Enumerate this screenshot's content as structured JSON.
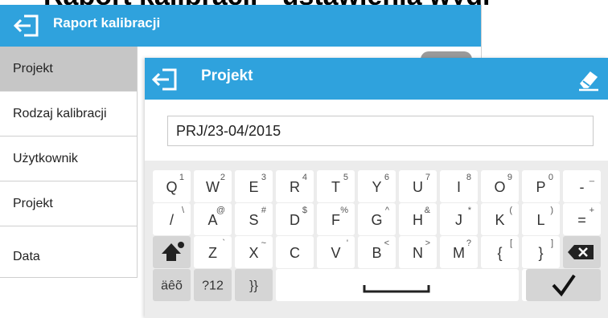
{
  "caption": "Raport kalibracji - ustawienia wydruku projektu",
  "bg_window": {
    "title": "Raport kalibracji",
    "rows": [
      "Projekt",
      "Rodzaj kalibracji",
      "Użytkownik",
      "Projekt",
      "Data"
    ]
  },
  "dialog": {
    "title": "Projekt",
    "input_value": "PRJ/23-04/2015"
  },
  "keyboard": {
    "row1": [
      {
        "main": "Q",
        "sup": "1"
      },
      {
        "main": "W",
        "sup": "2"
      },
      {
        "main": "E",
        "sup": "3"
      },
      {
        "main": "R",
        "sup": "4"
      },
      {
        "main": "T",
        "sup": "5"
      },
      {
        "main": "Y",
        "sup": "6"
      },
      {
        "main": "U",
        "sup": "7"
      },
      {
        "main": "I",
        "sup": "8"
      },
      {
        "main": "O",
        "sup": "9"
      },
      {
        "main": "P",
        "sup": "0"
      },
      {
        "main": "-",
        "sup": "_"
      }
    ],
    "row2": [
      {
        "main": "/",
        "sup": "\\"
      },
      {
        "main": "A",
        "sup": "@"
      },
      {
        "main": "S",
        "sup": "#"
      },
      {
        "main": "D",
        "sup": "$"
      },
      {
        "main": "F",
        "sup": "%"
      },
      {
        "main": "G",
        "sup": "^"
      },
      {
        "main": "H",
        "sup": "&"
      },
      {
        "main": "J",
        "sup": "*"
      },
      {
        "main": "K",
        "sup": "("
      },
      {
        "main": "L",
        "sup": ")"
      },
      {
        "main": "=",
        "sup": "+"
      }
    ],
    "row3": [
      {
        "main": "Z",
        "sup": "`"
      },
      {
        "main": "X",
        "sup": "~"
      },
      {
        "main": "C",
        "sup": ""
      },
      {
        "main": "V",
        "sup": "'"
      },
      {
        "main": "B",
        "sup": "<"
      },
      {
        "main": "N",
        "sup": ">"
      },
      {
        "main": "M",
        "sup": "?"
      },
      {
        "main": "{",
        "sup": "["
      },
      {
        "main": "}",
        "sup": "]"
      }
    ],
    "accents_label": "äêõ",
    "numbers_label": "?12",
    "symbols_label": "}}",
    "dot_label": ".",
    "dot_sup": ","
  },
  "colors": {
    "accent": "#2fa2dd",
    "key_bg": "#ffffff",
    "key_dark": "#d5d5d5",
    "panel": "#ececec"
  },
  "icons": {
    "back": "back-arrow-icon",
    "eraser": "eraser-icon",
    "shift": "shift-icon",
    "backspace": "backspace-icon",
    "space": "space-icon",
    "enter": "checkmark-icon"
  }
}
